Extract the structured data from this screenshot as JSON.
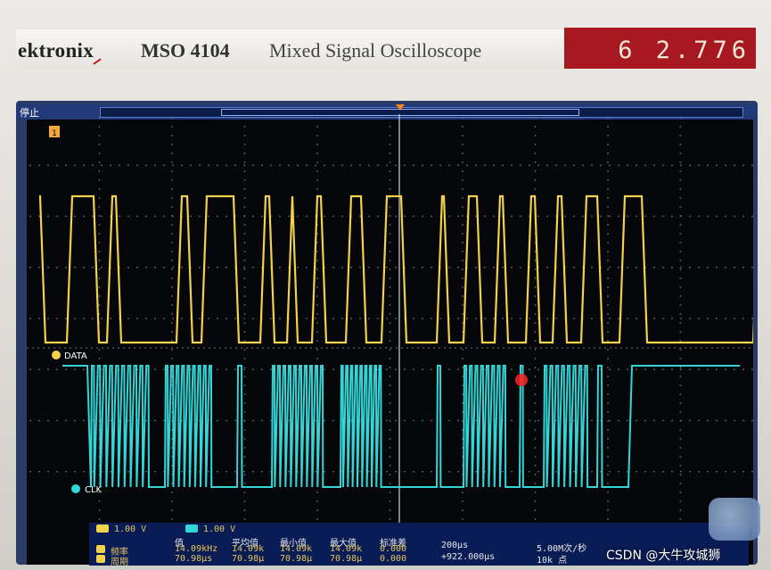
{
  "header": {
    "brand": "ektronix",
    "model": "MSO 4104",
    "subtitle": "Mixed Signal Oscilloscope",
    "counter": "6 2.776"
  },
  "status": {
    "run_state": "停止",
    "ch1_marker": "1"
  },
  "channels": {
    "data_label": "DATA",
    "clk_label": "CLK",
    "ch1_scale": "1.00 V",
    "ch2_scale": "1.00 V"
  },
  "measurements": {
    "headers": [
      "值",
      "平均值",
      "最小值",
      "最大值",
      "标准差"
    ],
    "rows": [
      {
        "marker": "1",
        "name": "频率",
        "values": [
          "14.09kHz",
          "14.09k",
          "14.09k",
          "14.09k",
          "0.000"
        ]
      },
      {
        "marker": "1",
        "name": "周期",
        "values": [
          "70.98µs",
          "70.98µ",
          "70.98µ",
          "70.98µ",
          "0.000"
        ]
      }
    ]
  },
  "timebase": {
    "scale": "200µs",
    "position": "+922.000µs",
    "sample_rate": "5.00M次/秒",
    "record_length": "10k 点"
  },
  "watermark": "CSDN @大牛攻城狮",
  "colors": {
    "data_trace": "#f2d24a",
    "clk_trace": "#33d6d6",
    "screen_bg": "#05070b",
    "frame": "#2a3c66",
    "counter_bg": "#a81820"
  }
}
